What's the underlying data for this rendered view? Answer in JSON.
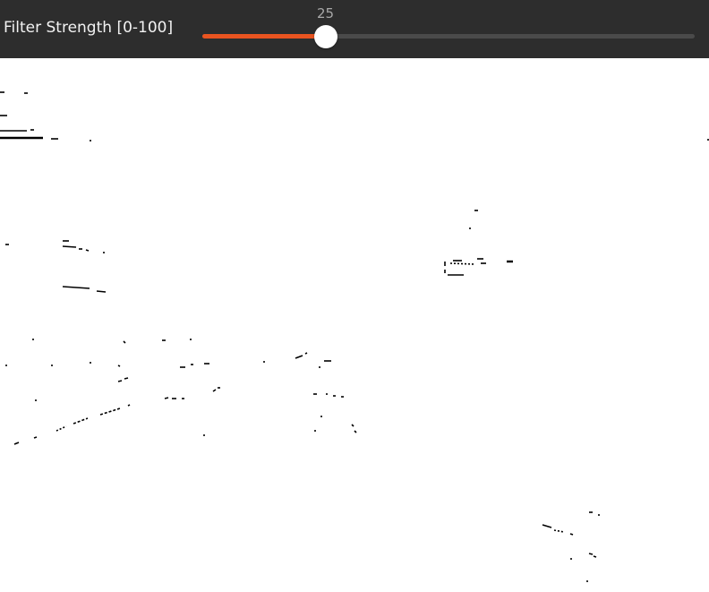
{
  "control": {
    "label": "Filter Strength [0-100]",
    "value": "25",
    "fraction": 0.25,
    "accent_color": "#e95420"
  },
  "image": {
    "description_icon": "edge-filtered-image"
  }
}
